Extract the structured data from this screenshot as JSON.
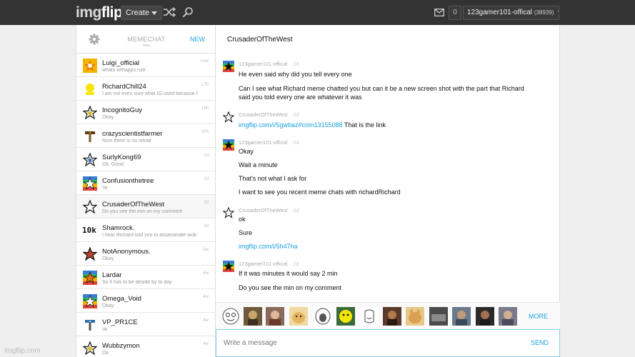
{
  "header": {
    "logo_part1": "img",
    "logo_part2": "flip",
    "create_label": "Create",
    "notification_count": "0",
    "username": "123gamer101-offical",
    "points": "(38939)"
  },
  "sidebar": {
    "title": "MEMECHAT",
    "subtitle": "beta",
    "new_label": "NEW",
    "items": [
      {
        "name": "Luigi_official",
        "preview": "whats behapps rule",
        "time": "now"
      },
      {
        "name": "RichardChill24",
        "preview": "I am not even sure what IG used because t",
        "time": "17h"
      },
      {
        "name": "IncognitoGuy",
        "preview": "Okay",
        "time": "19h"
      },
      {
        "name": "crazyscientistfarmer",
        "preview": "Nvm there is no retrial",
        "time": "20h"
      },
      {
        "name": "SurlyKong69",
        "preview": "Ok. Good",
        "time": "1d"
      },
      {
        "name": "Confusionthetree",
        "preview": "Ye",
        "time": "1d"
      },
      {
        "name": "CrusaderOfTheWest",
        "preview": "Do you see the min on my comment",
        "time": "2d"
      },
      {
        "name": "Shamrock.",
        "preview": "I hear Richard told you to assassinate wub",
        "time": "2d"
      },
      {
        "name": "NotAnonymous.",
        "preview": "Okay",
        "time": "2w"
      },
      {
        "name": "Lardar",
        "preview": "So it has to be deside by to day",
        "time": "4w"
      },
      {
        "name": "Omega_Void",
        "preview": "Okay",
        "time": "4w"
      },
      {
        "name": "VP_PR1CE",
        "preview": "ok",
        "time": "4w"
      },
      {
        "name": "Wubbzymon",
        "preview": "Da",
        "time": "4w"
      }
    ]
  },
  "chat": {
    "title": "CrusaderOfTheWest",
    "messages": [
      {
        "author": "123gamer101-offical",
        "time": "2d",
        "lines": [
          "He even said why did you tell every one",
          "Can I see what Richard meme chatted you but can it be a new screen shot with the part that Richard",
          "said you told every one are whatever it was"
        ]
      },
      {
        "author": "CrusaderOfTheWest",
        "time": "2d",
        "link": "imgflip.com/i/5gwbaz#com13155088",
        "after": " That is the link"
      },
      {
        "author": "123gamer101-offical",
        "time": "2d",
        "lines": [
          "Okay",
          "Wait a minute",
          "That's not what I ask for",
          "I want to see you recent meme chats with richardRichard"
        ]
      },
      {
        "author": "CrusaderOfTheWest",
        "time": "2d",
        "lines": [
          "ok",
          "Sure"
        ],
        "link": "imgflip.com/i/5h47ha"
      },
      {
        "author": "123gamer101-offical",
        "time": "2d",
        "lines": [
          "If it was minutes it would say 2 min",
          "Do you see the min on my comment"
        ]
      }
    ],
    "more_label": "MORE",
    "input_placeholder": "Write a message",
    "send_label": "SEND"
  },
  "watermark": "imgflip.com"
}
